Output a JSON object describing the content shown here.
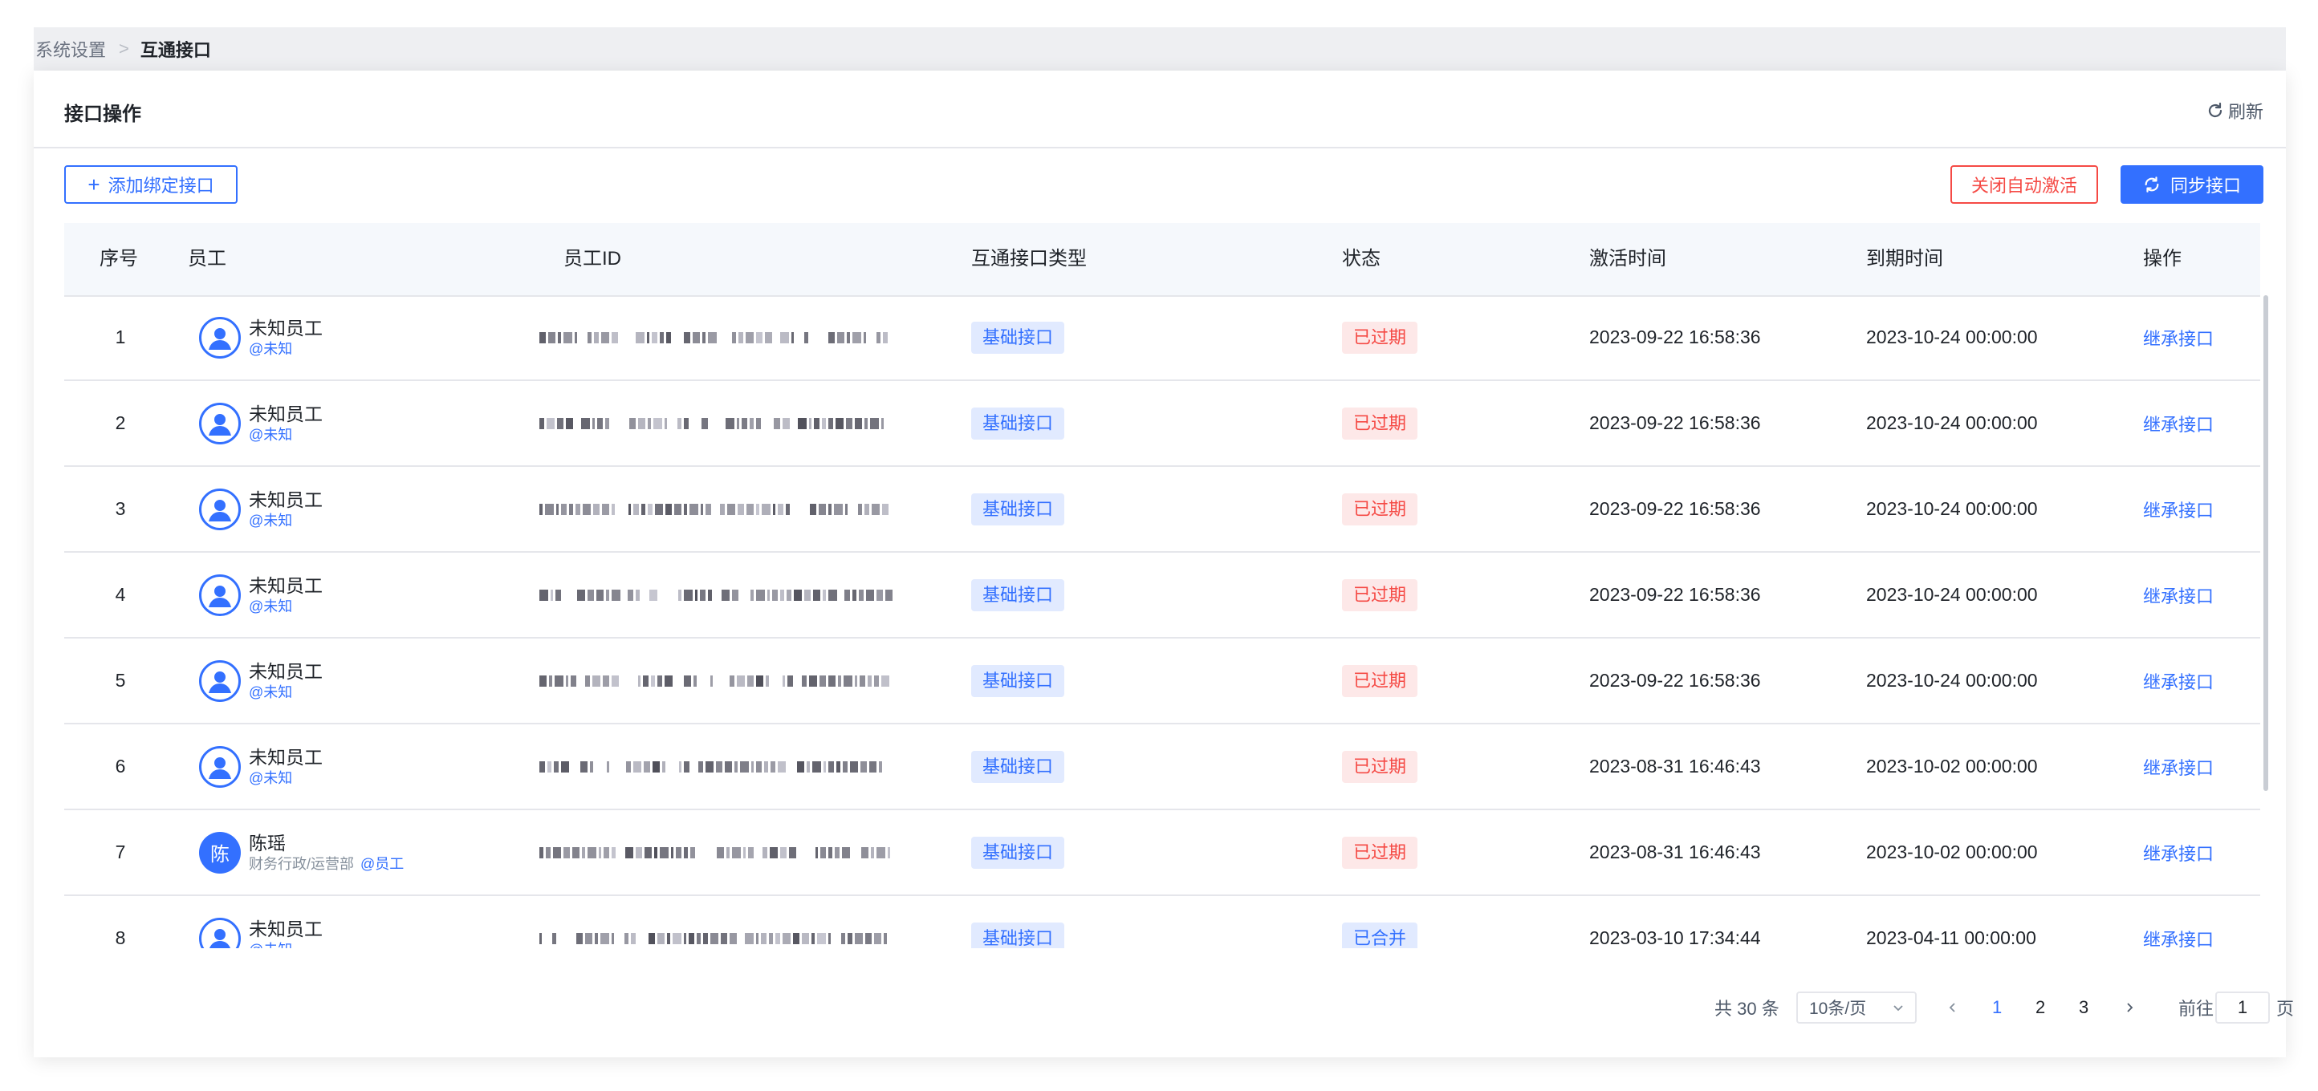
{
  "breadcrumb": {
    "root": "系统设置",
    "separator": ">",
    "current": "互通接口"
  },
  "header": {
    "title": "接口操作",
    "refresh_label": "刷新"
  },
  "toolbar": {
    "add_label": "添加绑定接口",
    "close_auto_label": "关闭自动激活",
    "sync_label": "同步接口"
  },
  "table": {
    "columns": [
      "序号",
      "员工",
      "员工ID",
      "互通接口类型",
      "状态",
      "激活时间",
      "到期时间",
      "操作"
    ],
    "rows": [
      {
        "idx": "1",
        "name": "未知员工",
        "sub": "@未知",
        "avatar": "ring",
        "type": "基础接口",
        "status": "已过期",
        "status_kind": "expired",
        "activated": "2023-09-22 16:58:36",
        "expires": "2023-10-24 00:00:00",
        "op": "继承接口"
      },
      {
        "idx": "2",
        "name": "未知员工",
        "sub": "@未知",
        "avatar": "ring",
        "type": "基础接口",
        "status": "已过期",
        "status_kind": "expired",
        "activated": "2023-09-22 16:58:36",
        "expires": "2023-10-24 00:00:00",
        "op": "继承接口"
      },
      {
        "idx": "3",
        "name": "未知员工",
        "sub": "@未知",
        "avatar": "ring",
        "type": "基础接口",
        "status": "已过期",
        "status_kind": "expired",
        "activated": "2023-09-22 16:58:36",
        "expires": "2023-10-24 00:00:00",
        "op": "继承接口"
      },
      {
        "idx": "4",
        "name": "未知员工",
        "sub": "@未知",
        "avatar": "ring",
        "type": "基础接口",
        "status": "已过期",
        "status_kind": "expired",
        "activated": "2023-09-22 16:58:36",
        "expires": "2023-10-24 00:00:00",
        "op": "继承接口"
      },
      {
        "idx": "5",
        "name": "未知员工",
        "sub": "@未知",
        "avatar": "ring",
        "type": "基础接口",
        "status": "已过期",
        "status_kind": "expired",
        "activated": "2023-09-22 16:58:36",
        "expires": "2023-10-24 00:00:00",
        "op": "继承接口"
      },
      {
        "idx": "6",
        "name": "未知员工",
        "sub": "@未知",
        "avatar": "ring",
        "type": "基础接口",
        "status": "已过期",
        "status_kind": "expired",
        "activated": "2023-08-31 16:46:43",
        "expires": "2023-10-02 00:00:00",
        "op": "继承接口"
      },
      {
        "idx": "7",
        "name": "陈瑶",
        "avatar_text": "陈",
        "dept": "财务行政/运营部",
        "sub": "@员工",
        "avatar": "solid",
        "type": "基础接口",
        "status": "已过期",
        "status_kind": "expired",
        "activated": "2023-08-31 16:46:43",
        "expires": "2023-10-02 00:00:00",
        "op": "继承接口"
      },
      {
        "idx": "8",
        "name": "未知员工",
        "sub": "@未知",
        "avatar": "ring",
        "type": "基础接口",
        "status": "已合并",
        "status_kind": "merged",
        "activated": "2023-03-10 17:34:44",
        "expires": "2023-04-11 00:00:00",
        "op": "继承接口"
      }
    ]
  },
  "pagination": {
    "total_label": "共 30 条",
    "page_size": "10条/页",
    "pages": [
      "1",
      "2",
      "3"
    ],
    "current_page": "1",
    "goto_label": "前往",
    "goto_value": "1",
    "goto_suffix": "页"
  },
  "colors": {
    "primary": "#3370ff",
    "danger": "#f54a45"
  }
}
